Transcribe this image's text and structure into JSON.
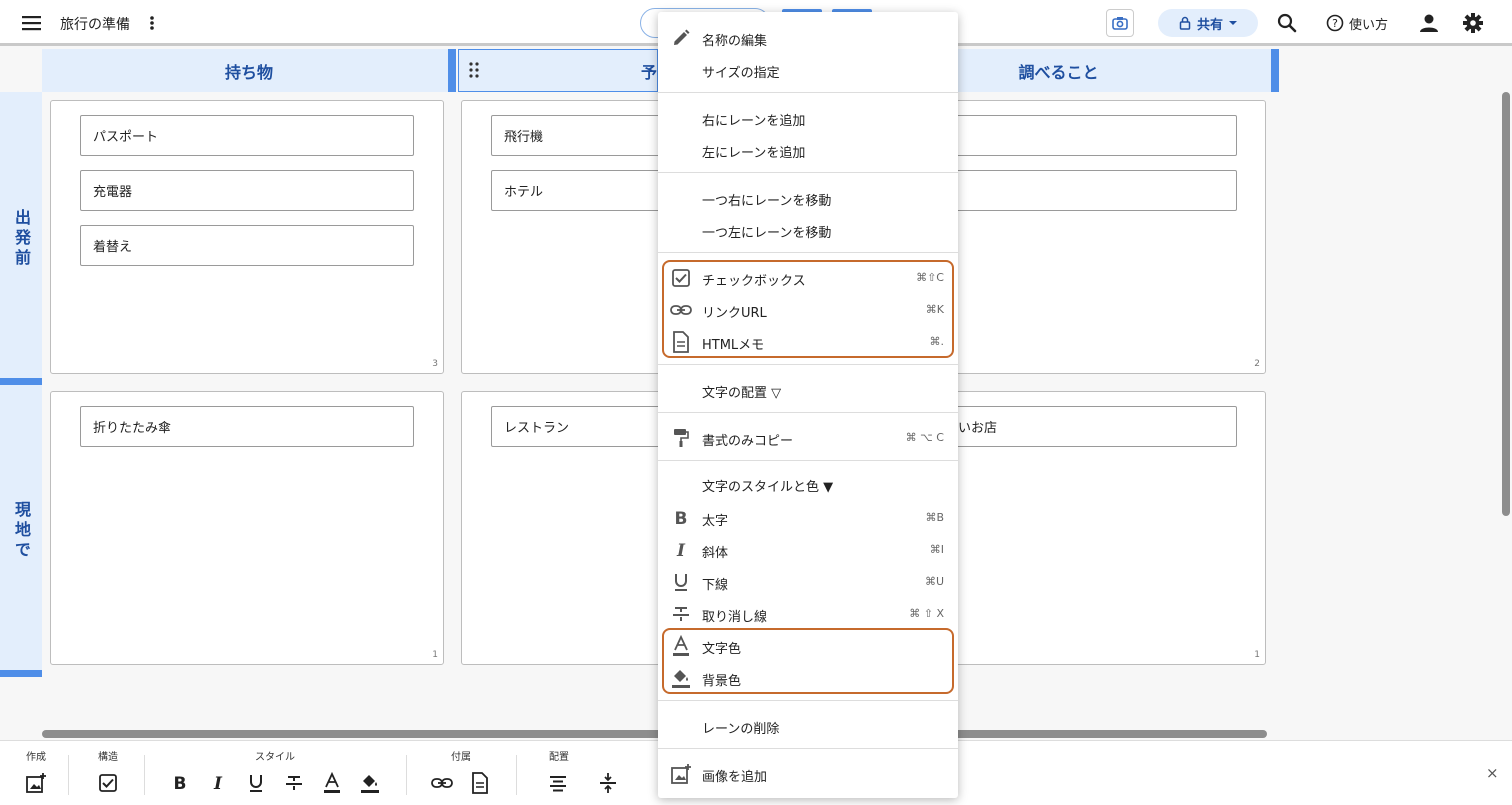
{
  "header": {
    "title": "旅行の準備",
    "share_label": "共有",
    "help_label": "使い方"
  },
  "board": {
    "columns": [
      "持ち物",
      "予",
      "調べること"
    ],
    "rows": [
      "出発前",
      "現地で"
    ],
    "cells": {
      "r0c0": {
        "cards": [
          "パスポート",
          "充電器",
          "着替え"
        ],
        "count": "3"
      },
      "r0c1": {
        "cards": [
          "飛行機",
          "ホテル"
        ]
      },
      "r0c2": {
        "count": "2"
      },
      "r1c0": {
        "cards": [
          "折りたたみ傘"
        ],
        "count": "1"
      },
      "r1c1": {
        "cards": [
          "レストラン"
        ]
      },
      "r1c2": {
        "cards": [
          "いお店"
        ],
        "count": "1"
      }
    }
  },
  "footer": {
    "groups": [
      "作成",
      "構造",
      "スタイル",
      "付属",
      "配置"
    ],
    "close": "×"
  },
  "menu": {
    "items": [
      {
        "label": "名称の編集",
        "icon": "pencil-icon"
      },
      {
        "label": "サイズの指定"
      },
      {
        "label": "右にレーンを追加"
      },
      {
        "label": "左にレーンを追加"
      },
      {
        "label": "一つ右にレーンを移動"
      },
      {
        "label": "一つ左にレーンを移動"
      },
      {
        "label": "チェックボックス",
        "icon": "checkbox-icon",
        "shortcut": "⌘⇧C"
      },
      {
        "label": "リンクURL",
        "icon": "link-icon",
        "shortcut": "⌘K"
      },
      {
        "label": "HTMLメモ",
        "icon": "document-icon",
        "shortcut": "⌘."
      },
      {
        "label": "文字の配置 ▽"
      },
      {
        "label": "書式のみコピー",
        "icon": "paint-roller-icon",
        "shortcut": "⌘ ⌥ C"
      },
      {
        "label": "文字のスタイルと色 ▼"
      },
      {
        "label": "太字",
        "icon": "bold-icon",
        "shortcut": "⌘B"
      },
      {
        "label": "斜体",
        "icon": "italic-icon",
        "shortcut": "⌘I"
      },
      {
        "label": "下線",
        "icon": "underline-icon",
        "shortcut": "⌘U"
      },
      {
        "label": "取り消し線",
        "icon": "strikethrough-icon",
        "shortcut": "⌘ ⇧ X"
      },
      {
        "label": "文字色",
        "icon": "text-color-icon"
      },
      {
        "label": "背景色",
        "icon": "fill-color-icon"
      },
      {
        "label": "レーンの削除"
      },
      {
        "label": "画像を追加",
        "icon": "add-image-icon"
      }
    ]
  },
  "colors": {
    "accent": "#4f8ee8",
    "header_bg": "#e3eefc",
    "header_text": "#1f4fa0",
    "highlight": "#c66a2c"
  }
}
